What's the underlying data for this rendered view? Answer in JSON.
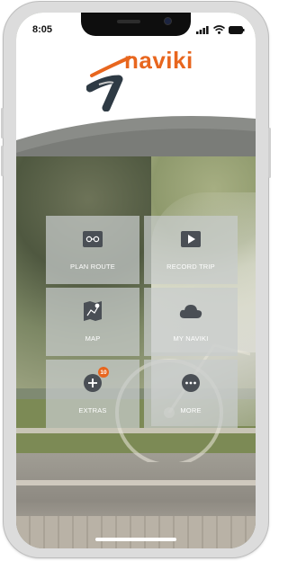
{
  "status_bar": {
    "time": "8:05"
  },
  "brand": {
    "name": "naviki"
  },
  "menu": {
    "plan_route": {
      "label": "PLAN ROUTE",
      "icon": "route-icon"
    },
    "record_trip": {
      "label": "RECORD TRIP",
      "icon": "play-icon"
    },
    "map": {
      "label": "MAP",
      "icon": "map-icon"
    },
    "my_naviki": {
      "label": "MY NAVIKI",
      "icon": "cloud-icon"
    },
    "extras": {
      "label": "EXTRAS",
      "icon": "plus-icon",
      "badge": "10"
    },
    "more": {
      "label": "MORE",
      "icon": "ellipsis-icon"
    }
  },
  "colors": {
    "accent": "#e8661e",
    "tile_bg": "#c8cccc",
    "icon_bg": "#4a4f55"
  }
}
